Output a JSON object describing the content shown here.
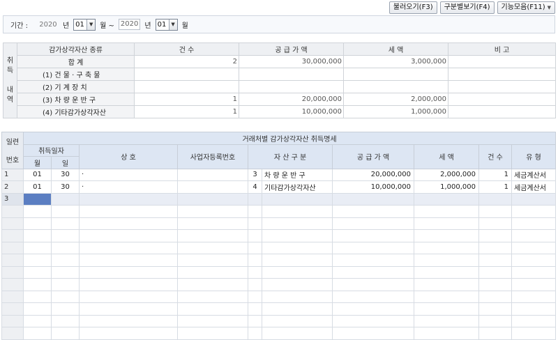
{
  "toolbar": {
    "load_label": "불러오기(F3)",
    "view_by_type_label": "구분별보기(F4)",
    "functions_label": "기능모음(F11)"
  },
  "period": {
    "label": "기간 :",
    "from_year": "2020",
    "year_unit": "년",
    "from_month": "01",
    "month_unit": "월 ~",
    "to_year": "2020",
    "to_year_unit": "년",
    "to_month": "01",
    "to_month_unit": "월"
  },
  "summary": {
    "side_label": "취득내역",
    "side_chars": [
      "취",
      "득",
      "",
      "내",
      "역"
    ],
    "headers": [
      "감가상각자산 종류",
      "건      수",
      "공 급 가 액",
      "세      액",
      "비      고"
    ],
    "rows": [
      {
        "label": "합        계",
        "count": "2",
        "supply": "30,000,000",
        "tax": "3,000,000",
        "note": ""
      },
      {
        "label": "(1) 건 물 · 구 축 물",
        "count": "",
        "supply": "",
        "tax": "",
        "note": ""
      },
      {
        "label": "(2) 기    계    장    치",
        "count": "",
        "supply": "",
        "tax": "",
        "note": ""
      },
      {
        "label": "(3) 차  량  운  반  구",
        "count": "1",
        "supply": "20,000,000",
        "tax": "2,000,000",
        "note": ""
      },
      {
        "label": "(4) 기타감가상각자산",
        "count": "1",
        "supply": "10,000,000",
        "tax": "1,000,000",
        "note": ""
      }
    ]
  },
  "detail": {
    "title": "거래처별 감가상각자산 취득명세",
    "h_seq_top": "일련",
    "h_seq_bottom": "번호",
    "h_acq_date": "취득일자",
    "h_month": "월",
    "h_day": "일",
    "h_company": "상          호",
    "h_bizno": "사업자등록번호",
    "h_asset_type": "자 산 구 분",
    "h_supply": "공 급 가 액",
    "h_tax": "세        액",
    "h_count": "건  수",
    "h_kind": "유    형",
    "rows": [
      {
        "no": "1",
        "month": "01",
        "day": "30",
        "company": "·",
        "bizno": "",
        "code": "3",
        "asset": "차  량  운  반  구",
        "supply": "20,000,000",
        "tax": "2,000,000",
        "count": "1",
        "kind": "세금계산서"
      },
      {
        "no": "2",
        "month": "01",
        "day": "30",
        "company": "·",
        "bizno": "",
        "code": "4",
        "asset": "기타감가상각자산",
        "supply": "10,000,000",
        "tax": "1,000,000",
        "count": "1",
        "kind": "세금계산서"
      },
      {
        "no": "3",
        "month": "",
        "day": "",
        "company": "",
        "bizno": "",
        "code": "",
        "asset": "",
        "supply": "",
        "tax": "",
        "count": "",
        "kind": ""
      }
    ]
  }
}
